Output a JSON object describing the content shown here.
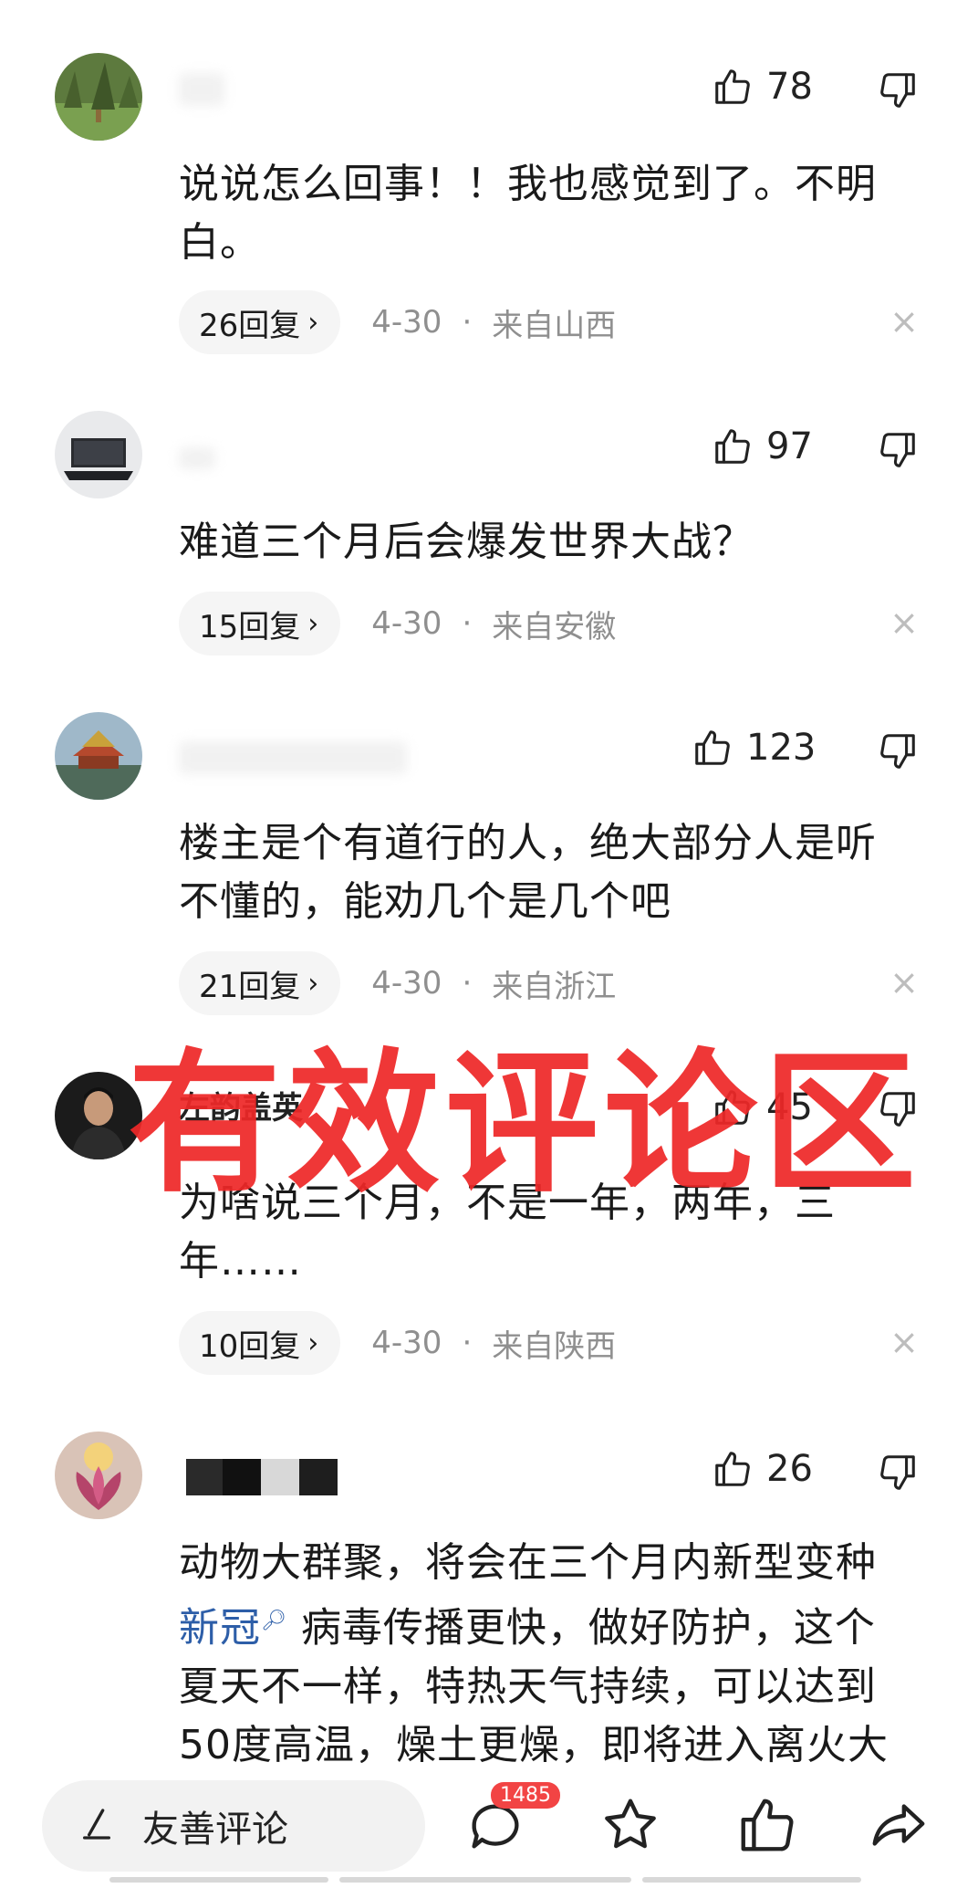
{
  "comments": [
    {
      "likes": "78",
      "text": "说说怎么回事！！我也感觉到了。不明白。",
      "text_lines": [
        "说说怎么回事！！我也感觉到了。不明",
        "白。"
      ],
      "replies": "26回复",
      "date": "4-30",
      "location": "来自山西"
    },
    {
      "likes": "97",
      "text": "难道三个月后会爆发世界大战？",
      "replies": "15回复",
      "date": "4-30",
      "location": "来自安徽"
    },
    {
      "likes": "123",
      "text_lines": [
        "楼主是个有道行的人，绝大部分人是听",
        "不懂的，能劝几个是几个吧"
      ],
      "replies": "21回复",
      "date": "4-30",
      "location": "来自浙江"
    },
    {
      "username": "左韵盖英",
      "likes": "45",
      "text_lines": [
        "为啥说三个月，不是一年，两年，三",
        "年……"
      ],
      "replies": "10回复",
      "date": "4-30",
      "location": "来自陕西"
    },
    {
      "likes": "26",
      "text_lines": [
        "动物大群聚，将会在三个月内新型变种",
        "病毒传播更快，做好防护，这个",
        "夏天不一样，特热天气持续，可以达到",
        "50度高温，燥土更燥，即将进入离火大"
      ],
      "link_word": "新冠"
    }
  ],
  "separator": "·",
  "chevron": "›",
  "close_symbol": "×",
  "watermark": "有效评论区",
  "bottom_bar": {
    "input_placeholder": "友善评论",
    "comment_count_badge": "1485",
    "icons": [
      "comment-icon",
      "star-icon",
      "thumbs-up-icon",
      "share-icon"
    ]
  },
  "colors": {
    "watermark": "#ee2828",
    "link": "#2d5ea8",
    "badge": "#f24444",
    "meta_text": "#8f8f8f"
  }
}
